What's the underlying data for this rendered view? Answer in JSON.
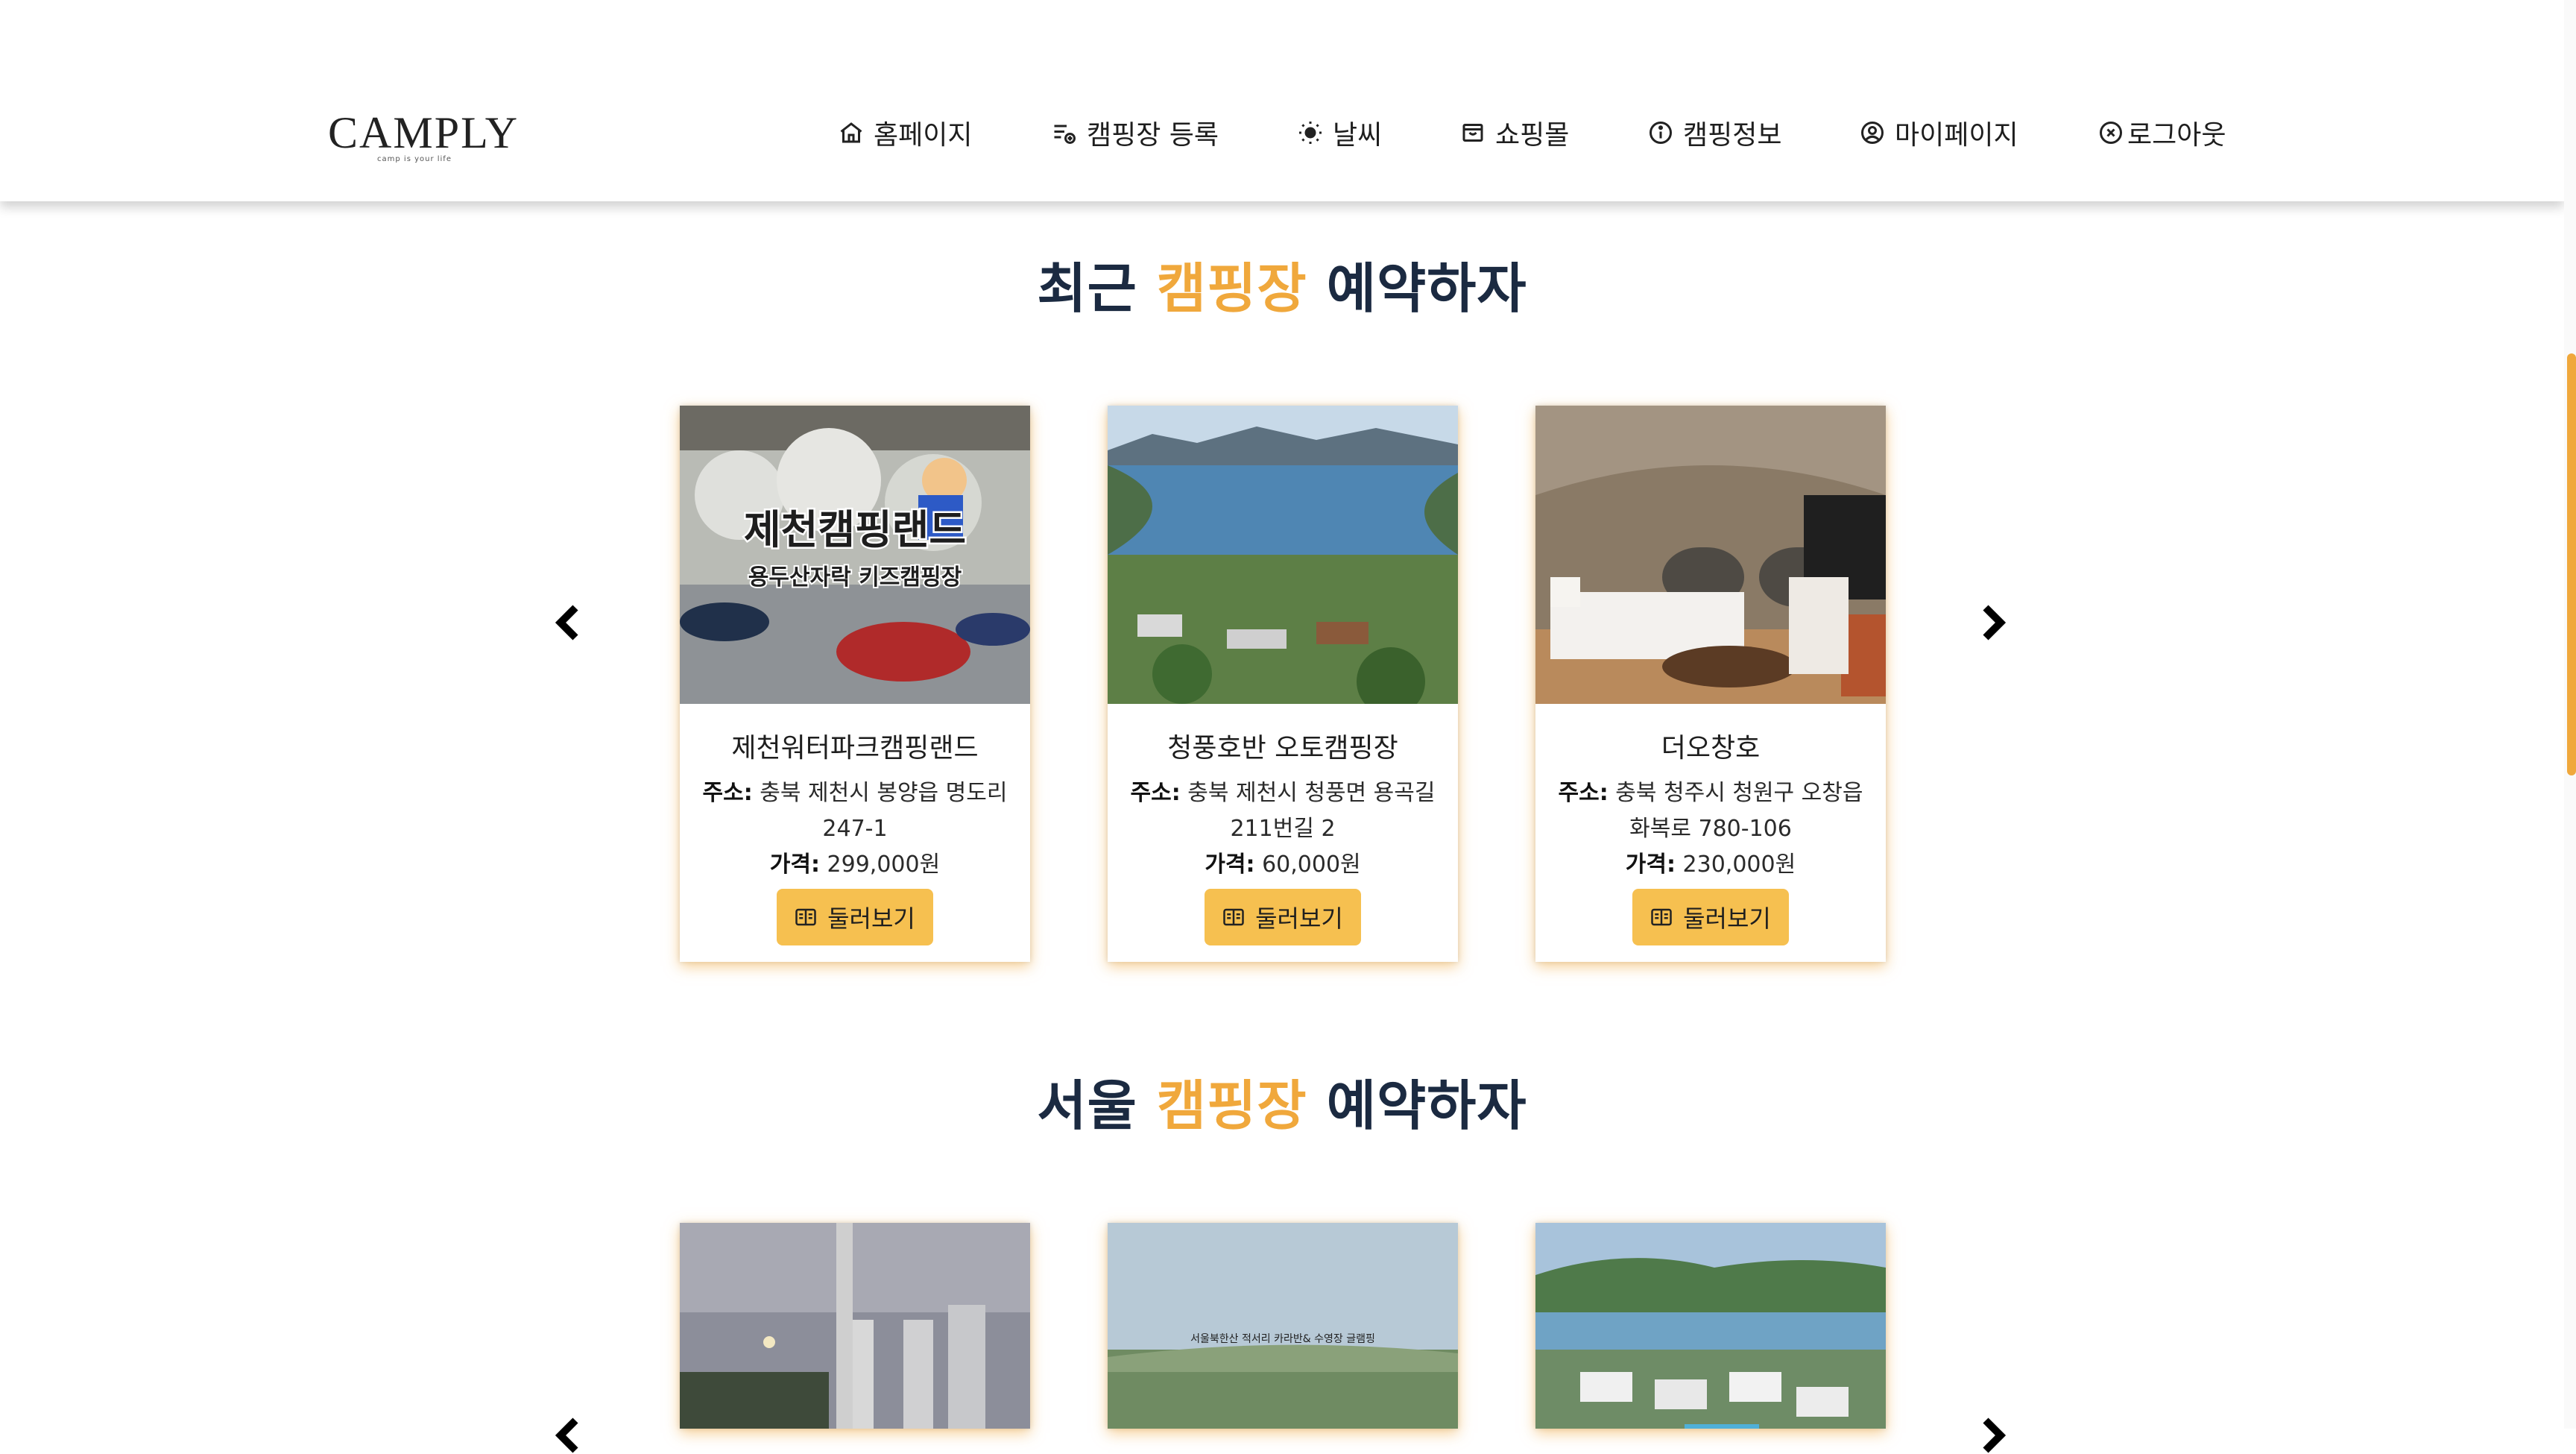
{
  "header": {
    "logo_text": "CAMPLY",
    "logo_tagline": "camp is your life",
    "nav": [
      {
        "label": "홈페이지",
        "icon": "home-icon"
      },
      {
        "label": "캠핑장 등록",
        "icon": "list-add-icon"
      },
      {
        "label": "날씨",
        "icon": "sun-icon"
      },
      {
        "label": "쇼핑몰",
        "icon": "shop-icon"
      },
      {
        "label": "캠핑정보",
        "icon": "info-icon"
      },
      {
        "label": "마이페이지",
        "icon": "user-circle-icon"
      },
      {
        "label": "로그아웃",
        "icon": "close-circle-icon"
      }
    ]
  },
  "colors": {
    "accent": "#f0a83c",
    "title": "#1b2a41",
    "button": "#f6c050"
  },
  "recent": {
    "title_pre": "최근",
    "title_accent": "캠핑장",
    "title_post": "예약하자",
    "cards": [
      {
        "name": "제천워터파크캠핑랜드",
        "address_label": "주소:",
        "address": "충북 제천시 봉양읍 명도리 247-1",
        "price_label": "가격:",
        "price": "299,000원",
        "button": "둘러보기",
        "image_text_main": "제천캠핑랜드",
        "image_text_sub": "용두산자락 키즈캠핑장"
      },
      {
        "name": "청풍호반 오토캠핑장",
        "address_label": "주소:",
        "address": "충북 제천시 청풍면 용곡길 211번길 2",
        "price_label": "가격:",
        "price": "60,000원",
        "button": "둘러보기"
      },
      {
        "name": "더오창호",
        "address_label": "주소:",
        "address": "충북 청주시 청원구 오창읍 화복로 780-106",
        "price_label": "가격:",
        "price": "230,000원",
        "button": "둘러보기"
      }
    ]
  },
  "seoul": {
    "title_pre": "서울",
    "title_accent": "캠핑장",
    "title_post": "예약하자",
    "image_caption": "서울북한산 적서리 카라반& 수영장 글램핑"
  }
}
